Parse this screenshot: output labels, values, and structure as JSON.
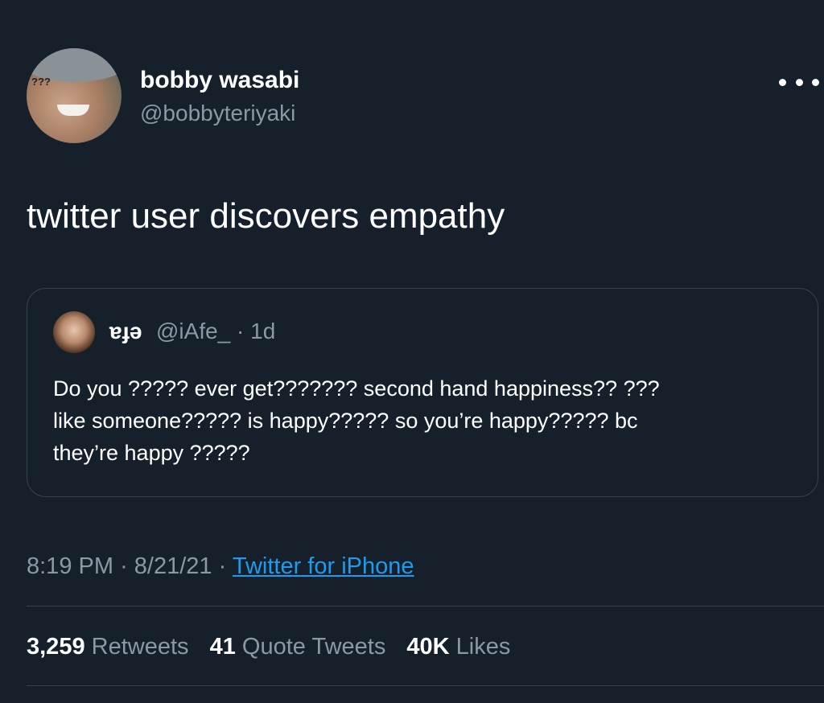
{
  "tweet": {
    "display_name": "bobby wasabi",
    "handle": "@bobbyteriyaki",
    "avatar_text": "???",
    "more_icon": "more-horizontal-icon",
    "text": "twitter user discovers empathy"
  },
  "quoted_tweet": {
    "display_name": "ɐɟǝ",
    "handle": "@iAfe_",
    "separator": "·",
    "age": "1d",
    "text_lines": [
      "Do you ????? ever get??????? second hand happiness?? ???",
      "like someone????? is happy????? so you’re happy????? bc",
      "they’re happy ?????"
    ]
  },
  "meta": {
    "time": "8:19 PM",
    "date": "8/21/21",
    "separator": "·",
    "source": "Twitter for iPhone"
  },
  "stats": {
    "retweets_count": "3,259",
    "retweets_label": "Retweets",
    "quote_tweets_count": "41",
    "quote_tweets_label": "Quote Tweets",
    "likes_count": "40K",
    "likes_label": "Likes"
  },
  "colors": {
    "background": "#15202b",
    "secondary_text": "#8b98a5",
    "link": "#1d9bf0",
    "border": "#38444d"
  }
}
